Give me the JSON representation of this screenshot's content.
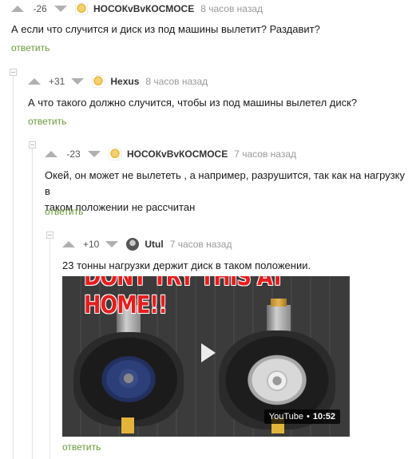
{
  "comments": [
    {
      "rating": "-26",
      "username": "НОСОКvВvКОСМОСЕ",
      "time": "8 часов назад",
      "text": [
        "А если что случится и диск из под машины вылетит? Раздавит?"
      ],
      "reply": "ответить"
    },
    {
      "rating": "+31",
      "username": "Hexus",
      "time": "8 часов назад",
      "text": [
        "А что такого должно случится, чтобы из под машины вылетел диск?"
      ],
      "reply": "ответить"
    },
    {
      "rating": "-23",
      "username": "НОСОКvВvКОСМОСЕ",
      "time": "7 часов назад",
      "text": [
        "Окей, он может не вылететь , а например, разрушится, так как на нагрузку в",
        "таком положении не рассчитан"
      ],
      "reply": "ответить"
    },
    {
      "rating": "+10",
      "username": "Utul",
      "time": "7 часов назад",
      "text": [
        "23 тонны нагрузки держит диск в таком положении."
      ],
      "reply": "ответить"
    }
  ],
  "video": {
    "banner": "DONT TRY THIS AT HOME!!",
    "source": "YouTube",
    "duration": "10:52"
  },
  "icons": {
    "upvote": "upvote-arrow-icon",
    "downvote": "downvote-arrow-icon",
    "collapse": "collapse-minus-icon",
    "play": "play-icon"
  },
  "colors": {
    "reply_link": "#6a9a3a",
    "vote_arrow": "#b0b0b0",
    "banner_text": "#e41e1e"
  }
}
